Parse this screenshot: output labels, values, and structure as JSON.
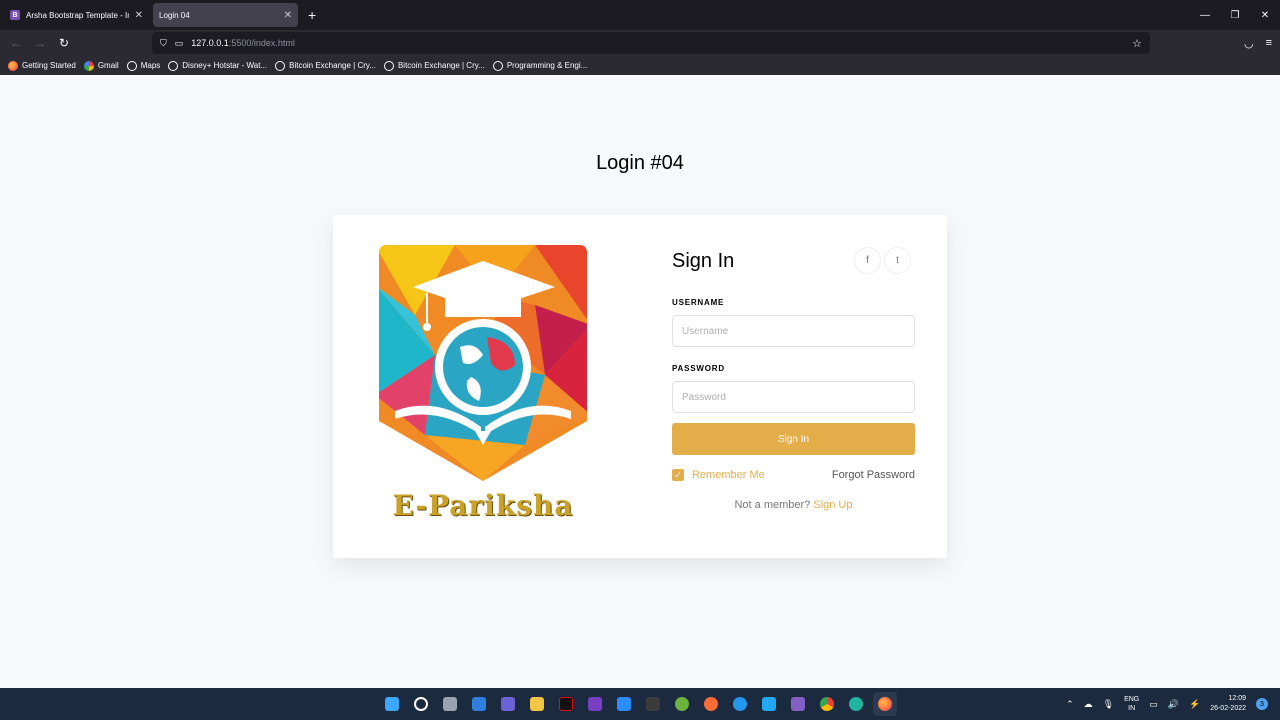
{
  "browser": {
    "tabs": [
      {
        "title": "Arsha Bootstrap Template - Index",
        "favicon": "B",
        "active": false
      },
      {
        "title": "Login 04",
        "active": true
      }
    ],
    "url_host": "127.0.0.1",
    "url_path": ":5500/index.html",
    "bookmarks": [
      {
        "label": "Getting Started",
        "icon": "firefox-icon"
      },
      {
        "label": "Gmail",
        "icon": "google-icon"
      },
      {
        "label": "Maps",
        "icon": "globe-icon"
      },
      {
        "label": "Disney+ Hotstar - Wat...",
        "icon": "globe-icon"
      },
      {
        "label": "Bitcoin Exchange | Cry...",
        "icon": "globe-icon"
      },
      {
        "label": "Bitcoin Exchange | Cry...",
        "icon": "globe-icon"
      },
      {
        "label": "Programming & Engi...",
        "icon": "globe-icon"
      }
    ]
  },
  "page": {
    "heading": "Login #04",
    "brand": "E-Pariksha",
    "form": {
      "title": "Sign In",
      "social": {
        "facebook": "f",
        "twitter": "t"
      },
      "username_label": "USERNAME",
      "username_placeholder": "Username",
      "password_label": "PASSWORD",
      "password_placeholder": "Password",
      "submit_label": "Sign In",
      "remember_label": "Remember Me",
      "remember_checked": true,
      "forgot_label": "Forgot Password",
      "member_text": "Not a member?",
      "signup_label": "Sign Up"
    },
    "accent_color": "#e3ad4a"
  },
  "taskbar": {
    "lang_top": "ENG",
    "lang_bottom": "IN",
    "time": "12:09",
    "date": "26-02-2022",
    "notifications": "3"
  }
}
